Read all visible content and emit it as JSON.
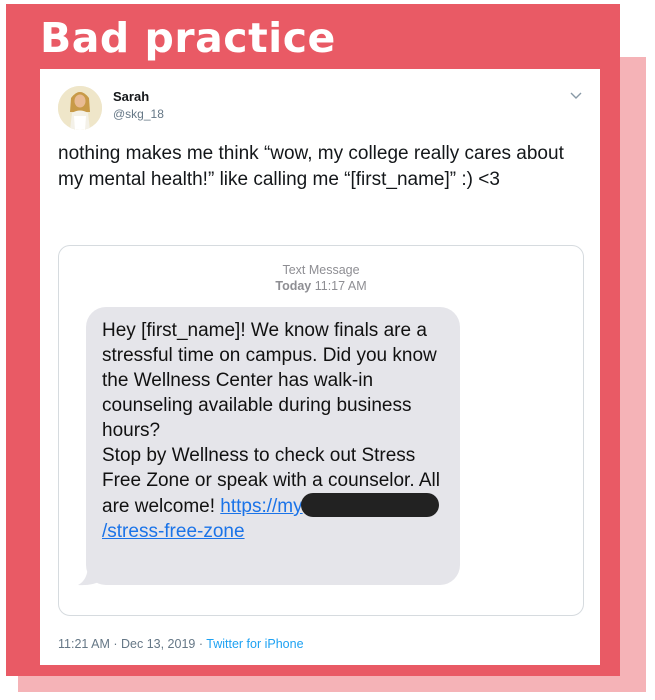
{
  "banner": {
    "title": "Bad practice"
  },
  "tweet": {
    "user": {
      "name": "Sarah",
      "handle": "@skg_18"
    },
    "text": "nothing makes me think “wow, my college really cares about my mental health!” like calling me “[first_name]” :) <3",
    "sms": {
      "header_label": "Text Message",
      "header_day": "Today",
      "header_time": "11:17 AM",
      "message_lines": [
        "Hey [first_name]! We know finals are a stressful time on campus. Did you know the Wellness Center has walk-in counseling available during business hours?",
        "Stop by Wellness to check out Stress Free Zone or speak with a counselor. All are welcome!"
      ],
      "link_start": "https://my",
      "link_end": "/stress-free-zone"
    },
    "timestamp": "11:21 AM · Dec 13, 2019",
    "separator": "·",
    "source": "Twitter for iPhone"
  },
  "colors": {
    "banner_bg": "#e95a65",
    "shadow_bg": "#f5b3b7",
    "link": "#1a73e8",
    "source_link": "#1da1f2"
  },
  "icons": [
    "avatar",
    "chevron-down-icon",
    "message-tail"
  ]
}
